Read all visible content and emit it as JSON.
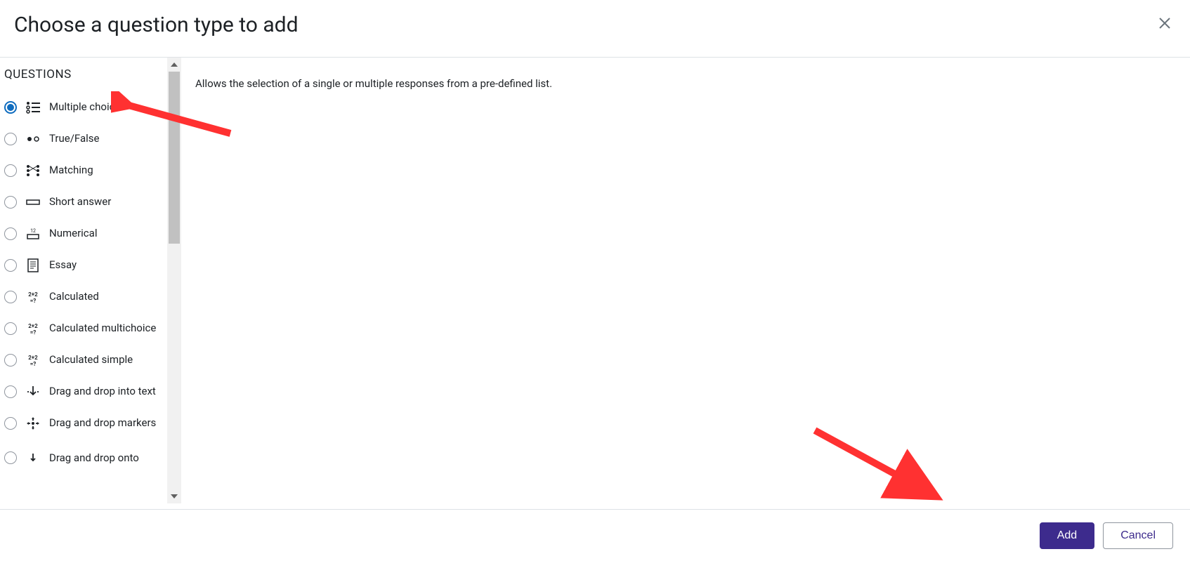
{
  "dialog": {
    "title": "Choose a question type to add"
  },
  "section_heading": "QUESTIONS",
  "question_types": [
    {
      "id": "multichoice",
      "label": "Multiple choice",
      "selected": true
    },
    {
      "id": "truefalse",
      "label": "True/False",
      "selected": false
    },
    {
      "id": "matching",
      "label": "Matching",
      "selected": false
    },
    {
      "id": "shortanswer",
      "label": "Short answer",
      "selected": false
    },
    {
      "id": "numerical",
      "label": "Numerical",
      "selected": false
    },
    {
      "id": "essay",
      "label": "Essay",
      "selected": false
    },
    {
      "id": "calculated",
      "label": "Calculated",
      "selected": false
    },
    {
      "id": "calculatedmulti",
      "label": "Calculated multichoice",
      "selected": false
    },
    {
      "id": "calculatedsimple",
      "label": "Calculated simple",
      "selected": false
    },
    {
      "id": "ddintotext",
      "label": "Drag and drop into text",
      "selected": false
    },
    {
      "id": "ddmarkers",
      "label": "Drag and drop markers",
      "selected": false
    },
    {
      "id": "ddontoimage",
      "label": "Drag and drop onto",
      "selected": false
    }
  ],
  "description": "Allows the selection of a single or multiple responses from a pre-defined list.",
  "buttons": {
    "add": "Add",
    "cancel": "Cancel"
  }
}
